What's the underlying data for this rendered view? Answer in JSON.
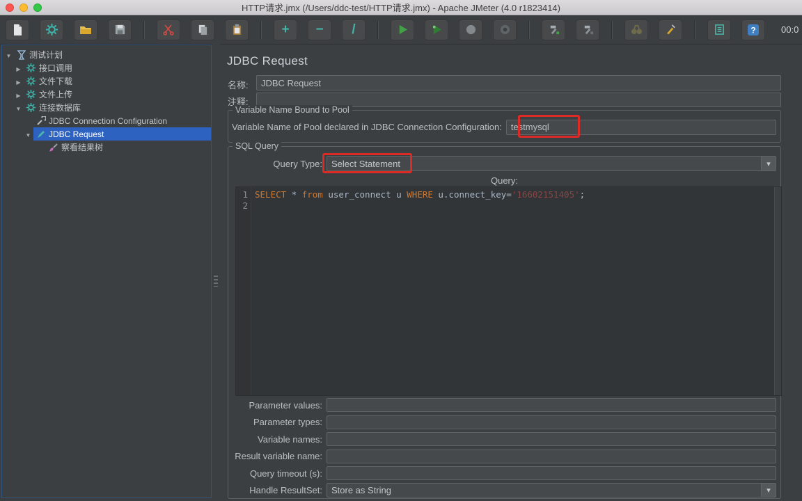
{
  "window": {
    "title": "HTTP请求.jmx (/Users/ddc-test/HTTP请求.jmx) - Apache JMeter (4.0 r1823414)"
  },
  "toolbar": {
    "timer": "00:0",
    "icons": [
      "new-file",
      "templates",
      "open-file",
      "save",
      "cut",
      "copy",
      "paste",
      "add",
      "remove",
      "toggle",
      "start",
      "start-no-pauses",
      "stop",
      "shutdown",
      "remote-start-all",
      "remote-stop-all",
      "search",
      "clear-all",
      "function-helper",
      "help"
    ]
  },
  "tree": {
    "items": [
      {
        "label": "测试计划"
      },
      {
        "label": "接口调用"
      },
      {
        "label": "文件下载"
      },
      {
        "label": "文件上传"
      },
      {
        "label": "连接数据库"
      },
      {
        "label": "JDBC Connection Configuration"
      },
      {
        "label": "JDBC Request"
      },
      {
        "label": "察看结果树"
      }
    ]
  },
  "main": {
    "title": "JDBC Request",
    "name": {
      "label": "名称:",
      "value": "JDBC Request"
    },
    "comments": {
      "label": "注释:",
      "value": ""
    },
    "pool": {
      "group_title": "Variable Name Bound to Pool",
      "label": "Variable Name of Pool declared in JDBC Connection Configuration:",
      "value": "testmysql"
    },
    "sql": {
      "group_title": "SQL Query",
      "query_type_label": "Query Type:",
      "query_type_value": "Select Statement",
      "query_label": "Query:",
      "line_numbers": {
        "l1": "1",
        "l2": "2"
      },
      "code": {
        "kw_select": "SELECT",
        "frag1": " * ",
        "kw_from": "from",
        "frag2": " user_connect u ",
        "kw_where": "WHERE",
        "frag3": " u.connect_key=",
        "str": "'16602151405'",
        "frag4": ";"
      },
      "rows": [
        {
          "label": "Parameter values:",
          "value": ""
        },
        {
          "label": "Parameter types:",
          "value": ""
        },
        {
          "label": "Variable names:",
          "value": ""
        },
        {
          "label": "Result variable name:",
          "value": ""
        },
        {
          "label": "Query timeout (s):",
          "value": ""
        },
        {
          "label": "Handle ResultSet:",
          "value": "Store as String"
        }
      ]
    }
  }
}
